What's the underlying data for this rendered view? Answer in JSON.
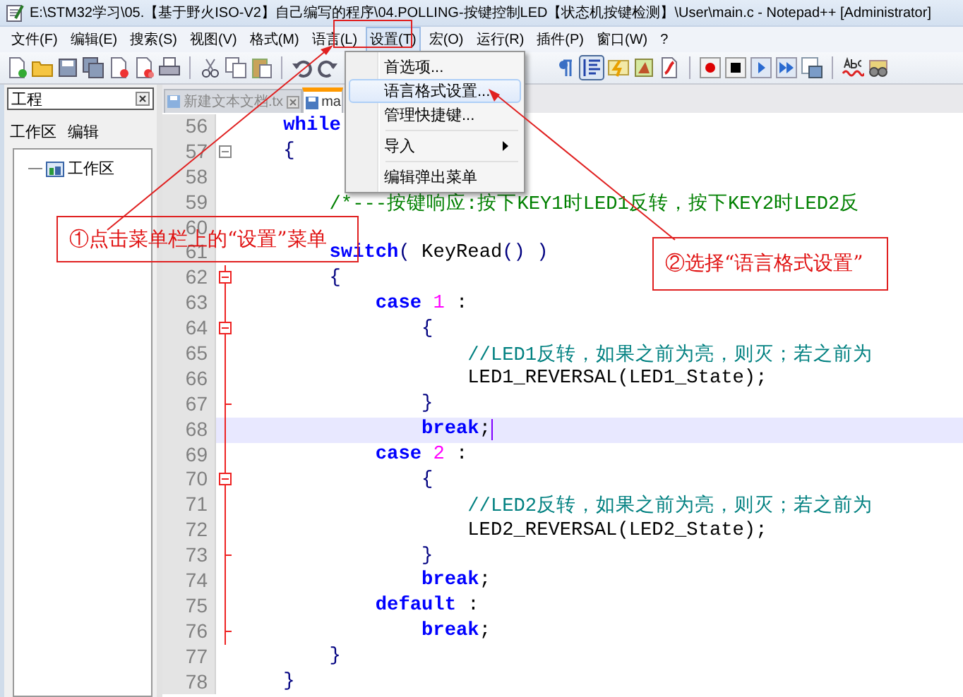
{
  "window": {
    "title": "E:\\STM32学习\\05.【基于野火ISO-V2】自己编写的程序\\04.POLLING-按键控制LED【状态机按键检测】\\User\\main.c - Notepad++ [Administrator]"
  },
  "menu_bar": {
    "items": [
      {
        "label": "文件(F)",
        "selected": false
      },
      {
        "label": "编辑(E)",
        "selected": false
      },
      {
        "label": "搜索(S)",
        "selected": false
      },
      {
        "label": "视图(V)",
        "selected": false
      },
      {
        "label": "格式(M)",
        "selected": false
      },
      {
        "label": "语言(L)",
        "selected": false
      },
      {
        "label": "设置(T)",
        "selected": true
      },
      {
        "label": "宏(O)",
        "selected": false
      },
      {
        "label": "运行(R)",
        "selected": false
      },
      {
        "label": "插件(P)",
        "selected": false
      },
      {
        "label": "窗口(W)",
        "selected": false
      },
      {
        "label": "?",
        "selected": false
      }
    ]
  },
  "project_panel": {
    "title": "工程",
    "links": [
      "工作区",
      "编辑"
    ],
    "tree": [
      {
        "label": "工作区"
      }
    ]
  },
  "editor": {
    "tabs": [
      {
        "label": "新建文本文档.tx",
        "selected": false
      },
      {
        "label": "ma",
        "selected": true
      }
    ],
    "lines": [
      {
        "number": "56",
        "in_block": false,
        "current": false,
        "tokens": [
          {
            "kind": "keyword",
            "text": "    while"
          }
        ]
      },
      {
        "number": "57",
        "fold_marker": {
          "kind": "toggle"
        },
        "in_block": false,
        "current": false,
        "tokens": [
          {
            "kind": "operator",
            "text": "    {"
          }
        ]
      },
      {
        "number": "58",
        "in_block": false,
        "current": false
      },
      {
        "number": "59",
        "in_block": false,
        "current": false,
        "tokens": [
          {
            "kind": "comment_block",
            "text": "        /*---按键响应:按下KEY1时LED1反转，按下KEY2时LED2反"
          }
        ]
      },
      {
        "number": "60",
        "in_block": false,
        "current": false
      },
      {
        "number": "61",
        "in_block": false,
        "current": false,
        "tokens": [
          {
            "kind": "keyword",
            "text": "        switch"
          },
          {
            "kind": "operator",
            "text": "( "
          },
          {
            "kind": "plain",
            "text": "KeyRead"
          },
          {
            "kind": "operator",
            "text": "() )"
          }
        ]
      },
      {
        "number": "62",
        "fold_marker": {
          "kind": "toggle"
        },
        "in_block": true,
        "current": false,
        "tokens": [
          {
            "kind": "operator",
            "text": "        {"
          }
        ]
      },
      {
        "number": "63",
        "in_block": true,
        "current": false,
        "tokens": [
          {
            "kind": "keyword",
            "text": "            case"
          },
          {
            "kind": "number",
            "text": " 1"
          },
          {
            "kind": "plain",
            "text": " :"
          }
        ]
      },
      {
        "number": "64",
        "fold_marker": {
          "kind": "toggle"
        },
        "in_block": true,
        "current": false,
        "tokens": [
          {
            "kind": "operator",
            "text": "                {"
          }
        ]
      },
      {
        "number": "65",
        "in_block": true,
        "current": false,
        "tokens": [
          {
            "kind": "comment_line",
            "text": "                    //LED1反转，如果之前为亮，则灭；若之前为"
          }
        ]
      },
      {
        "number": "66",
        "in_block": true,
        "current": false,
        "tokens": [
          {
            "kind": "plain",
            "text": "                    LED1_REVERSAL(LED1_State);"
          }
        ]
      },
      {
        "number": "67",
        "fold_marker": {
          "kind": "end"
        },
        "in_block": true,
        "current": false,
        "tokens": [
          {
            "kind": "operator",
            "text": "                }"
          }
        ]
      },
      {
        "number": "68",
        "in_block": true,
        "current": true,
        "tokens": [
          {
            "kind": "keyword",
            "text": "                break"
          },
          {
            "kind": "plain",
            "text": ";"
          }
        ]
      },
      {
        "number": "69",
        "in_block": true,
        "current": false,
        "tokens": [
          {
            "kind": "keyword",
            "text": "            case"
          },
          {
            "kind": "number",
            "text": " 2"
          },
          {
            "kind": "plain",
            "text": " :"
          }
        ]
      },
      {
        "number": "70",
        "fold_marker": {
          "kind": "toggle"
        },
        "in_block": true,
        "current": false,
        "tokens": [
          {
            "kind": "operator",
            "text": "                {"
          }
        ]
      },
      {
        "number": "71",
        "in_block": true,
        "current": false,
        "tokens": [
          {
            "kind": "comment_line",
            "text": "                    //LED2反转，如果之前为亮，则灭；若之前为"
          }
        ]
      },
      {
        "number": "72",
        "in_block": true,
        "current": false,
        "tokens": [
          {
            "kind": "plain",
            "text": "                    LED2_REVERSAL(LED2_State);"
          }
        ]
      },
      {
        "number": "73",
        "fold_marker": {
          "kind": "end"
        },
        "in_block": true,
        "current": false,
        "tokens": [
          {
            "kind": "operator",
            "text": "                }"
          }
        ]
      },
      {
        "number": "74",
        "in_block": true,
        "current": false,
        "tokens": [
          {
            "kind": "keyword",
            "text": "                break"
          },
          {
            "kind": "plain",
            "text": ";"
          }
        ]
      },
      {
        "number": "75",
        "in_block": true,
        "current": false,
        "tokens": [
          {
            "kind": "keyword",
            "text": "            default"
          },
          {
            "kind": "plain",
            "text": " :"
          }
        ]
      },
      {
        "number": "76",
        "fold_marker": {
          "kind": "end"
        },
        "in_block": true,
        "current": false,
        "tokens": [
          {
            "kind": "keyword",
            "text": "                break"
          },
          {
            "kind": "plain",
            "text": ";"
          }
        ]
      },
      {
        "number": "77",
        "in_block": false,
        "current": false,
        "tokens": [
          {
            "kind": "operator",
            "text": "        }"
          }
        ]
      },
      {
        "number": "78",
        "in_block": false,
        "current": false,
        "tokens": [
          {
            "kind": "operator",
            "text": "    }"
          }
        ]
      }
    ]
  },
  "dropdown": {
    "items": [
      {
        "kind": "item",
        "label": "首选项...",
        "selected": false
      },
      {
        "kind": "item",
        "label": "语言格式设置...",
        "selected": true
      },
      {
        "kind": "item",
        "label": "管理快捷键...",
        "selected": false
      },
      {
        "kind": "separator"
      },
      {
        "kind": "submenu",
        "label": "导入",
        "selected": false
      },
      {
        "kind": "separator"
      },
      {
        "kind": "item",
        "label": "编辑弹出菜单",
        "selected": false
      }
    ]
  },
  "annotations": [
    {
      "text": "①点击菜单栏上的“设置”菜单"
    },
    {
      "text": "②选择“语言格式设置”"
    }
  ]
}
